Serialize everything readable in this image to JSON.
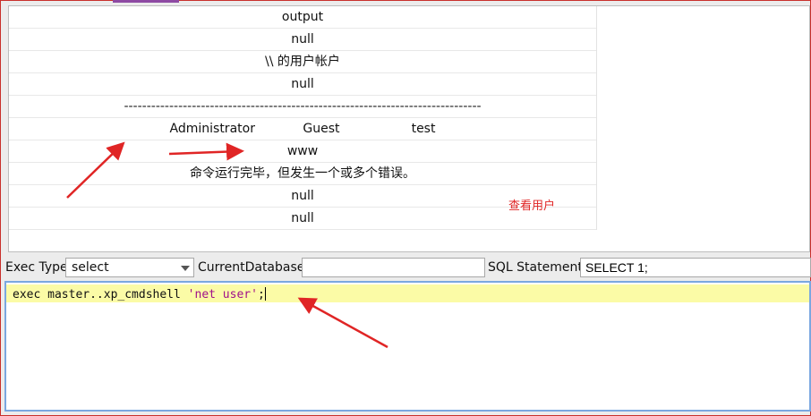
{
  "results": {
    "rows": [
      "output",
      "null",
      "\\\\ 的用户帐户",
      "null",
      "-------------------------------------------------------------------------------",
      "Administrator            Guest                  test",
      "www",
      "命令运行完毕，但发生一个或多个错误。",
      "null",
      "null"
    ]
  },
  "annotation": {
    "note": "查看用户"
  },
  "toolbar": {
    "exec_type_label": "Exec Type",
    "exec_type_value": "select",
    "current_database_label": "CurrentDatabase",
    "current_database_value": "",
    "sql_statement_label": "SQL Statement",
    "sql_statement_value": "SELECT 1;"
  },
  "editor": {
    "code_prefix": "exec master..xp_cmdshell ",
    "code_string": "'net user'",
    "code_suffix": ";"
  },
  "colors": {
    "accent": "#8e4aa3",
    "annotation_red": "#e02525",
    "editor_highlight": "#fbfba6",
    "string_literal": "#a0108a"
  }
}
